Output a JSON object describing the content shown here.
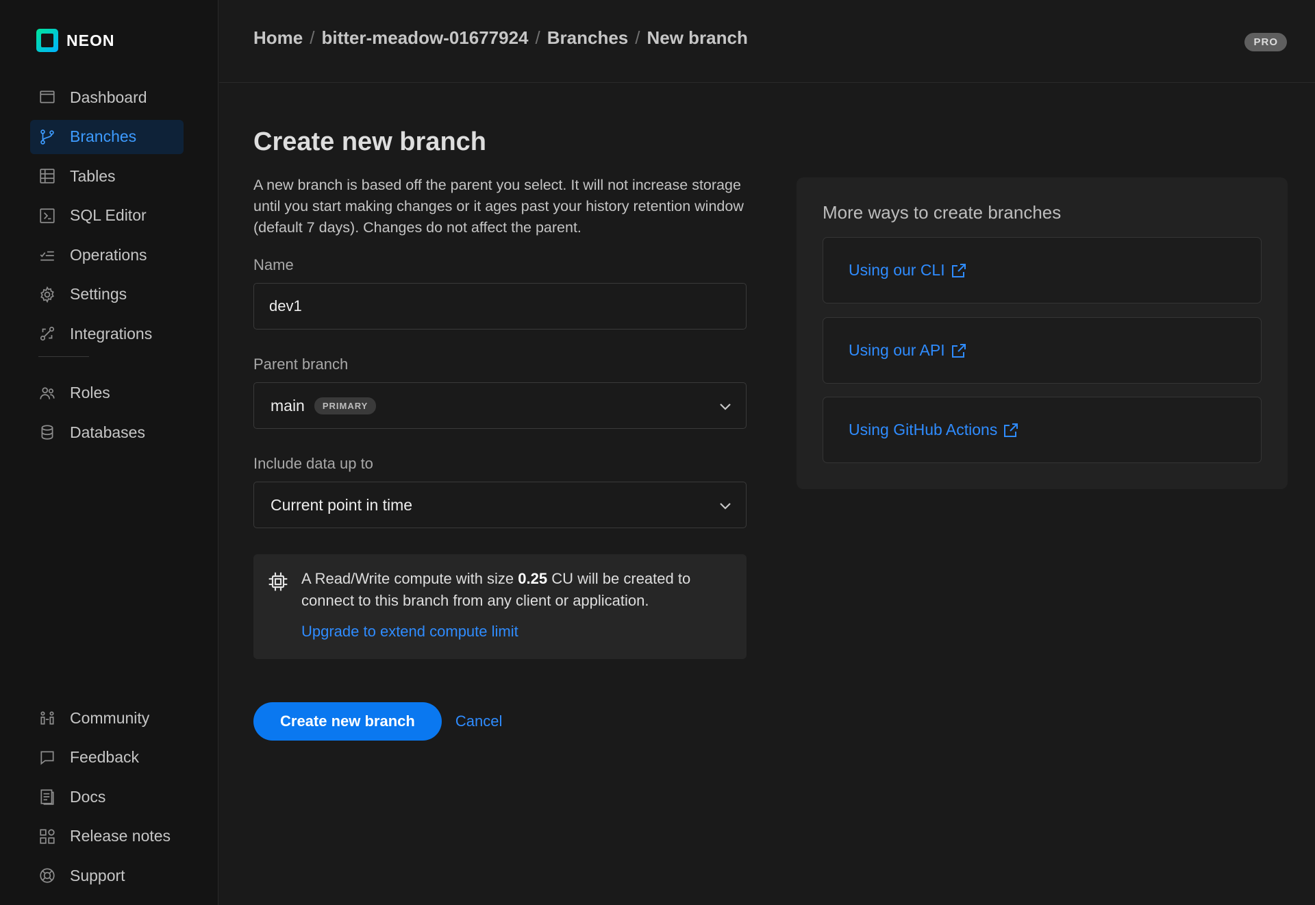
{
  "app": {
    "logo_text": "NEON",
    "plan_badge": "PRO"
  },
  "sidebar": {
    "top_items": [
      {
        "label": "Dashboard",
        "icon": "dashboard-icon"
      },
      {
        "label": "Branches",
        "icon": "branches-icon",
        "active": true
      },
      {
        "label": "Tables",
        "icon": "tables-icon"
      },
      {
        "label": "SQL Editor",
        "icon": "sql-editor-icon"
      },
      {
        "label": "Operations",
        "icon": "operations-icon"
      },
      {
        "label": "Settings",
        "icon": "gear-icon"
      },
      {
        "label": "Integrations",
        "icon": "integrations-icon"
      },
      {
        "label": "Roles",
        "icon": "roles-icon"
      },
      {
        "label": "Databases",
        "icon": "database-icon"
      }
    ],
    "bottom_items": [
      {
        "label": "Community",
        "icon": "community-icon"
      },
      {
        "label": "Feedback",
        "icon": "feedback-icon"
      },
      {
        "label": "Docs",
        "icon": "docs-icon"
      },
      {
        "label": "Release notes",
        "icon": "release-notes-icon"
      },
      {
        "label": "Support",
        "icon": "support-icon"
      }
    ]
  },
  "breadcrumb": {
    "home": "Home",
    "project": "bitter-meadow-01677924",
    "section": "Branches",
    "current": "New branch",
    "separator": "/"
  },
  "form": {
    "title": "Create new branch",
    "description": "A new branch is based off the parent you select. It will not increase storage until you start making changes or it ages past your history retention window (default 7 days). Changes do not affect the parent.",
    "name_label": "Name",
    "name_value": "dev1",
    "parent_label": "Parent branch",
    "parent_value": "main",
    "parent_tag": "PRIMARY",
    "data_label": "Include data up to",
    "data_value": "Current point in time",
    "info_prefix": "A Read/Write compute with size ",
    "info_size": "0.25",
    "info_suffix": " CU will be created to connect to this branch from any client or application.",
    "upgrade_link": "Upgrade to extend compute limit",
    "submit_label": "Create new branch",
    "cancel_label": "Cancel"
  },
  "side_panel": {
    "title": "More ways to create branches",
    "links": [
      "Using our CLI",
      "Using our API",
      "Using GitHub Actions"
    ]
  },
  "colors": {
    "accent": "#0a78f0",
    "link": "#2f8cff",
    "background": "#1a1a1a",
    "sidebar": "#141414"
  }
}
